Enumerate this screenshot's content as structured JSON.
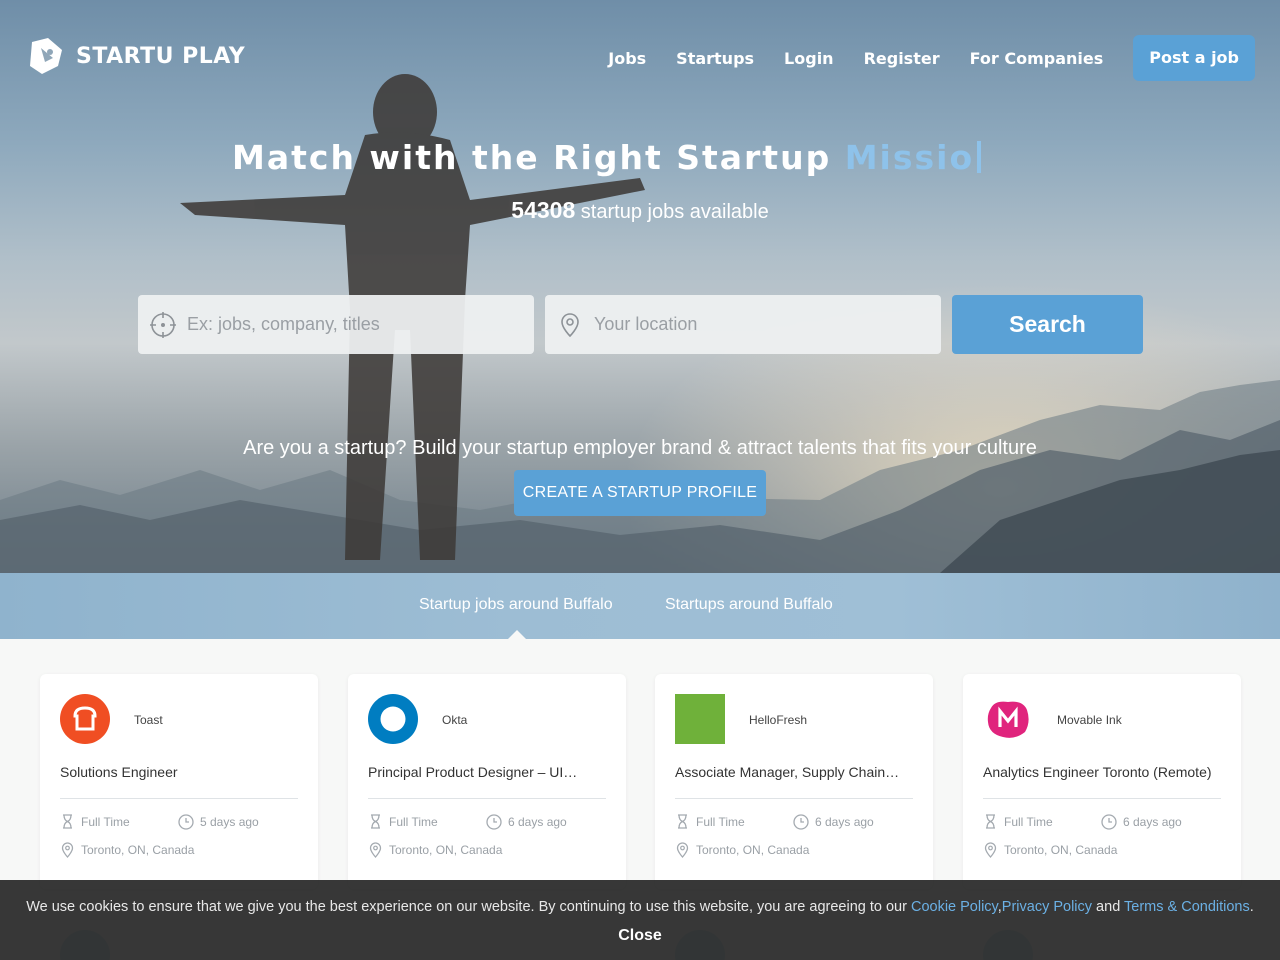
{
  "brand": {
    "name": "STARTU PLAY"
  },
  "nav": {
    "items": [
      "Jobs",
      "Startups",
      "Login",
      "Register",
      "For Companies"
    ],
    "post_job": "Post a job"
  },
  "hero": {
    "headline_static": "Match with the Right Startup",
    "headline_typed": "Missio",
    "job_count": "54308",
    "job_count_suffix": " startup jobs available",
    "search_placeholder": "Ex: jobs, company, titles",
    "location_placeholder": "Your location",
    "search_button": "Search",
    "promo_text": "Are you a startup? Build your startup employer brand & attract talents that fits your culture",
    "create_profile": "CREATE A STARTUP PROFILE"
  },
  "tabs": [
    "Startup jobs around Buffalo",
    "Startups around Buffalo"
  ],
  "cards": [
    {
      "company": "Toast",
      "title": "Solutions Engineer",
      "type": "Full Time",
      "posted": "5 days ago",
      "location": "Toronto, ON, Canada",
      "logo": "toast-logo",
      "color": "#f04e23"
    },
    {
      "company": "Okta",
      "title": "Principal Product Designer – UI…",
      "type": "Full Time",
      "posted": "6 days ago",
      "location": "Toronto, ON, Canada",
      "logo": "okta-logo",
      "color": "#007dc1"
    },
    {
      "company": "HelloFresh",
      "title": "Associate Manager, Supply Chain…",
      "type": "Full Time",
      "posted": "6 days ago",
      "location": "Toronto, ON, Canada",
      "logo": "hellofresh-logo",
      "color": "#5fa33a"
    },
    {
      "company": "Movable Ink",
      "title": "Analytics Engineer Toronto (Remote)",
      "type": "Full Time",
      "posted": "6 days ago",
      "location": "Toronto, ON, Canada",
      "logo": "movable-ink-logo",
      "color": "#e0247d"
    }
  ],
  "cookie": {
    "text_before": "We use cookies to ensure that we give you the best experience on our website. By continuing to use this website, you are agreeing to our ",
    "cookie_policy": "Cookie Policy",
    "sep1": ",",
    "privacy_policy": "Privacy Policy",
    "and": " and ",
    "terms": "Terms & Conditions",
    "period": ".",
    "close": "Close"
  }
}
